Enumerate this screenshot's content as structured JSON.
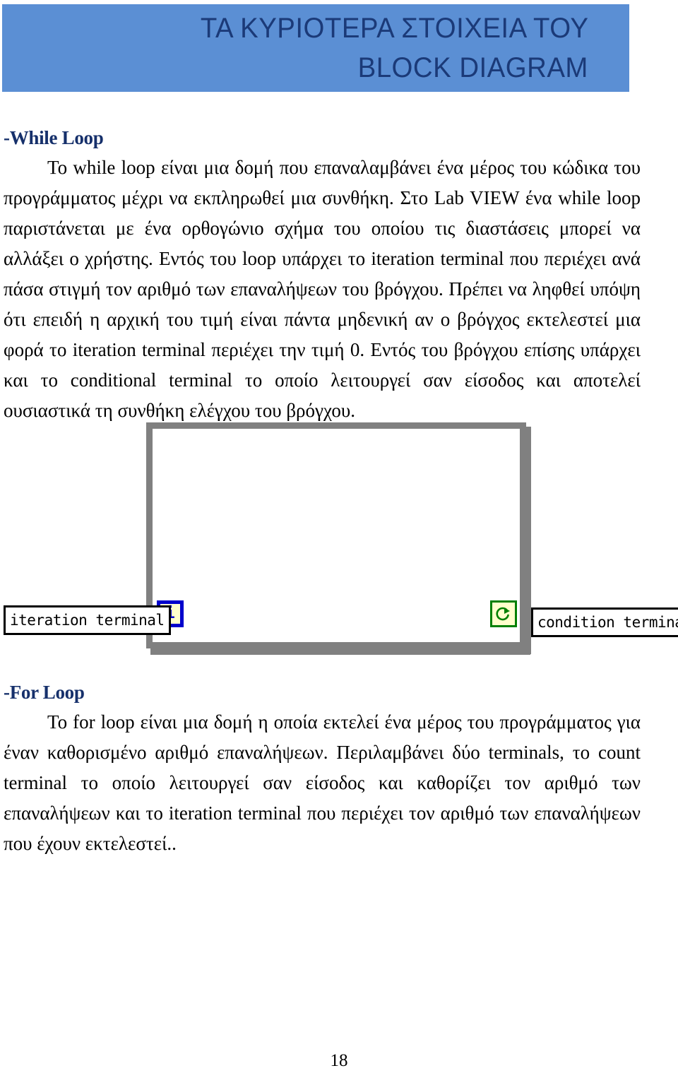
{
  "banner": {
    "line1": "ΤΑ ΚΥΡΙΟΤΕΡΑ ΣΤΟΙΧΕΙΑ ΤΟΥ",
    "line2": "BLOCK DIAGRAM",
    "background_color": "#5b8fd4",
    "text_color": "#1b3a78"
  },
  "sections": [
    {
      "heading": "-While Loop",
      "heading_color": "#16306b",
      "body": "Το while loop είναι μια δομή που επαναλαμβάνει ένα μέρος του κώδικα του προγράμματος μέχρι να εκπληρωθεί μια συνθήκη. Στο Lab VIEW ένα while loop παριστάνεται με ένα ορθογώνιο σχήμα του οποίου τις διαστάσεις μπορεί να αλλάξει ο χρήστης. Εντός του loop υπάρχει το iteration terminal που περιέχει ανά πάσα στιγμή τον αριθμό των επαναλήψεων του βρόγχου. Πρέπει να ληφθεί υπόψη ότι επειδή η αρχική του τιμή είναι πάντα μηδενική αν ο βρόγχος εκτελεστεί μια φορά το iteration terminal περιέχει την τιμή 0. Εντός του βρόγχου επίσης υπάρχει και το conditional terminal το οποίο λειτουργεί σαν είσοδος και αποτελεί ουσιαστικά τη συνθήκη ελέγχου του βρόγχου."
    },
    {
      "heading": "-For Loop",
      "heading_color": "#16306b",
      "body": "Το for loop είναι μια δομή η οποία εκτελεί ένα μέρος του προγράμματος για έναν καθορισμένο αριθμό επαναλήψεων. Περιλαμβάνει δύο terminals, το count terminal το οποίο λειτουργεί σαν είσοδος και καθορίζει τον αριθμό των επαναλήψεων και το iteration terminal που περιέχει τον αριθμό των επαναλήψεων που έχουν εκτελεστεί.."
    }
  ],
  "figure": {
    "caption_left": "iteration terminal",
    "caption_right": "condition terminal",
    "iteration_terminal_glyph": "i",
    "iteration_terminal_border_color": "#0000cc",
    "iteration_terminal_fill_color": "#ffffcc",
    "condition_terminal_icon": "loop-arrow-icon",
    "condition_terminal_border_color": "#008000",
    "condition_terminal_fill_color": "#ffffcc",
    "loop_border_color": "#808080"
  },
  "footer": {
    "page_number": "18"
  }
}
